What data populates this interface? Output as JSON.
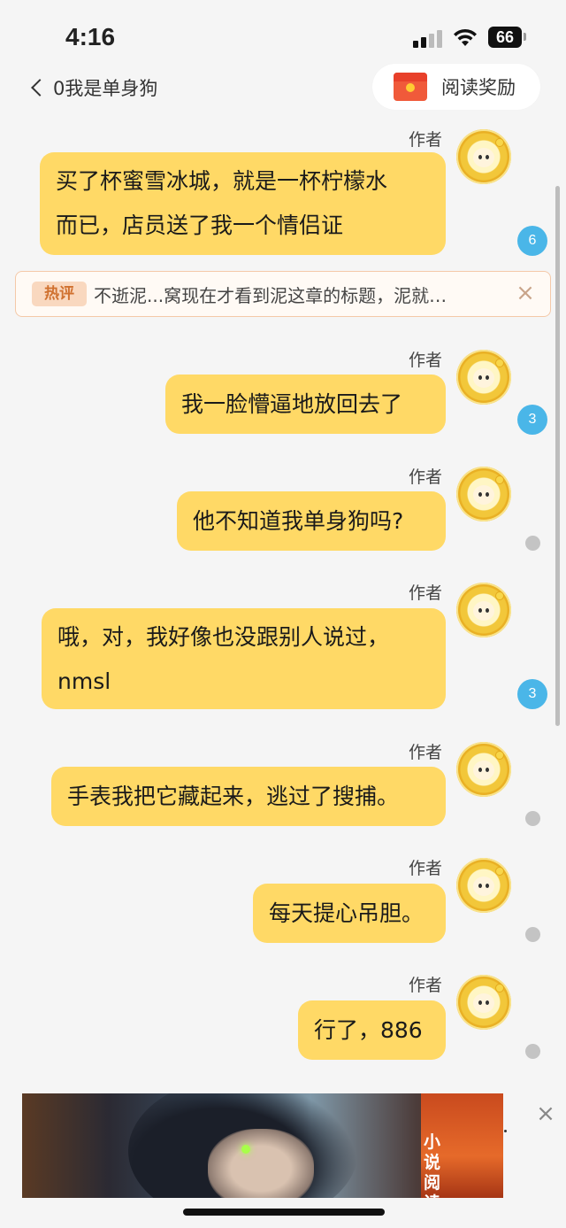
{
  "status_bar": {
    "time": "4:16",
    "battery": "66"
  },
  "header": {
    "back_title": "0我是单身狗",
    "reward_label": "阅读奖励"
  },
  "hot_comment": {
    "tag": "热评",
    "text": "不逝泥...窝现在才看到泥这章的标题，泥就…"
  },
  "messages": [
    {
      "author": "作者",
      "lines": [
        "买了杯蜜雪冰城，就是一杯柠檬水",
        "而已，店员送了我一个情侣证"
      ],
      "badge": "6"
    },
    {
      "author": "作者",
      "lines": [
        "我一脸懵逼地放回去了"
      ],
      "badge": "3"
    },
    {
      "author": "作者",
      "lines": [
        "他不知道我单身狗吗?"
      ],
      "badge": ""
    },
    {
      "author": "作者",
      "lines": [
        "哦，对，我好像也没跟别人说过，",
        "nmsl"
      ],
      "badge": "3"
    },
    {
      "author": "作者",
      "lines": [
        "手表我把它藏起来，逃过了搜捕。"
      ],
      "badge": ""
    },
    {
      "author": "作者",
      "lines": [
        "每天提心吊胆。"
      ],
      "badge": ""
    },
    {
      "author": "作者",
      "lines": [
        "行了，886"
      ],
      "badge": ""
    }
  ],
  "ad": {
    "label": "小说阅读"
  },
  "colors": {
    "bubble": "#ffd966",
    "badge": "#4ab6e8",
    "background": "#f5f5f5"
  }
}
